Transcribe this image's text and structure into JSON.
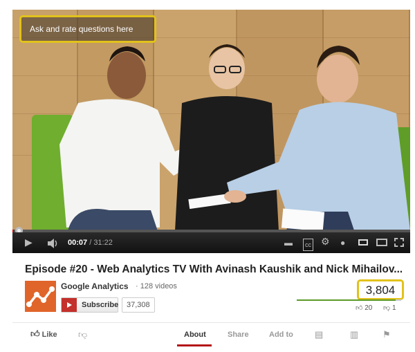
{
  "annotation_top": {
    "text": "Ask and rate questions here"
  },
  "player": {
    "time_current": "00:07",
    "time_duration": "/ 31:22",
    "progress_fraction": 0.004
  },
  "video": {
    "title": "Episode #20 - Web Analytics TV With Avinash Kaushik and Nick Mihailov...",
    "channel": "Google Analytics",
    "video_count": "· 128 videos",
    "subscribe_label": "Subscribe",
    "subscriber_count": "37,308",
    "views": "3,804",
    "likes": "20",
    "dislikes": "1",
    "like_fraction": 0.95
  },
  "actions": {
    "like_label": "Like",
    "tabs": [
      "About",
      "Share",
      "Add to"
    ]
  },
  "colors": {
    "annotation_border": "#e2c21b",
    "brand_red": "#b31217",
    "like_green": "#5b9a27",
    "logo_orange": "#e0652a"
  }
}
